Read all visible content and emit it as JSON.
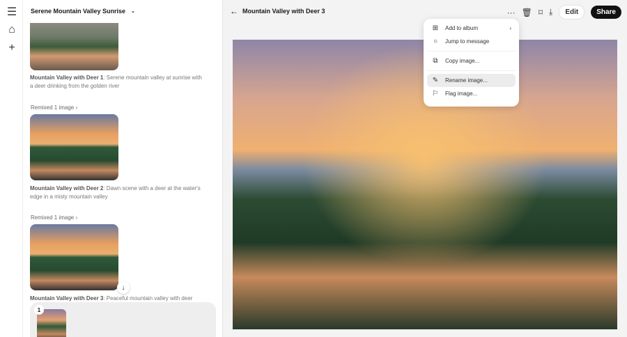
{
  "sidebar": {
    "title": "Serene Mountain Valley Sunrise",
    "items": [
      {
        "title": "Mountain Valley with Deer 1",
        "desc": ": Serene mountain valley at sunrise with a deer drinking from the golden river"
      },
      {
        "remix": "Remixed 1 image",
        "title": "Mountain Valley with Deer 2",
        "desc": ": Dawn scene with a deer at the water's edge in a misty mountain valley"
      },
      {
        "remix": "Remixed 1 image",
        "title": "Mountain Valley with Deer 3",
        "desc": ": Peaceful mountain valley with deer"
      }
    ],
    "tray_count": "1"
  },
  "main": {
    "title": "Mountain Valley with Deer 3",
    "edit": "Edit",
    "share": "Share"
  },
  "menu": {
    "items": [
      "Add to album",
      "Jump to message",
      "Copy image...",
      "Rename image...",
      "Flag image..."
    ]
  }
}
